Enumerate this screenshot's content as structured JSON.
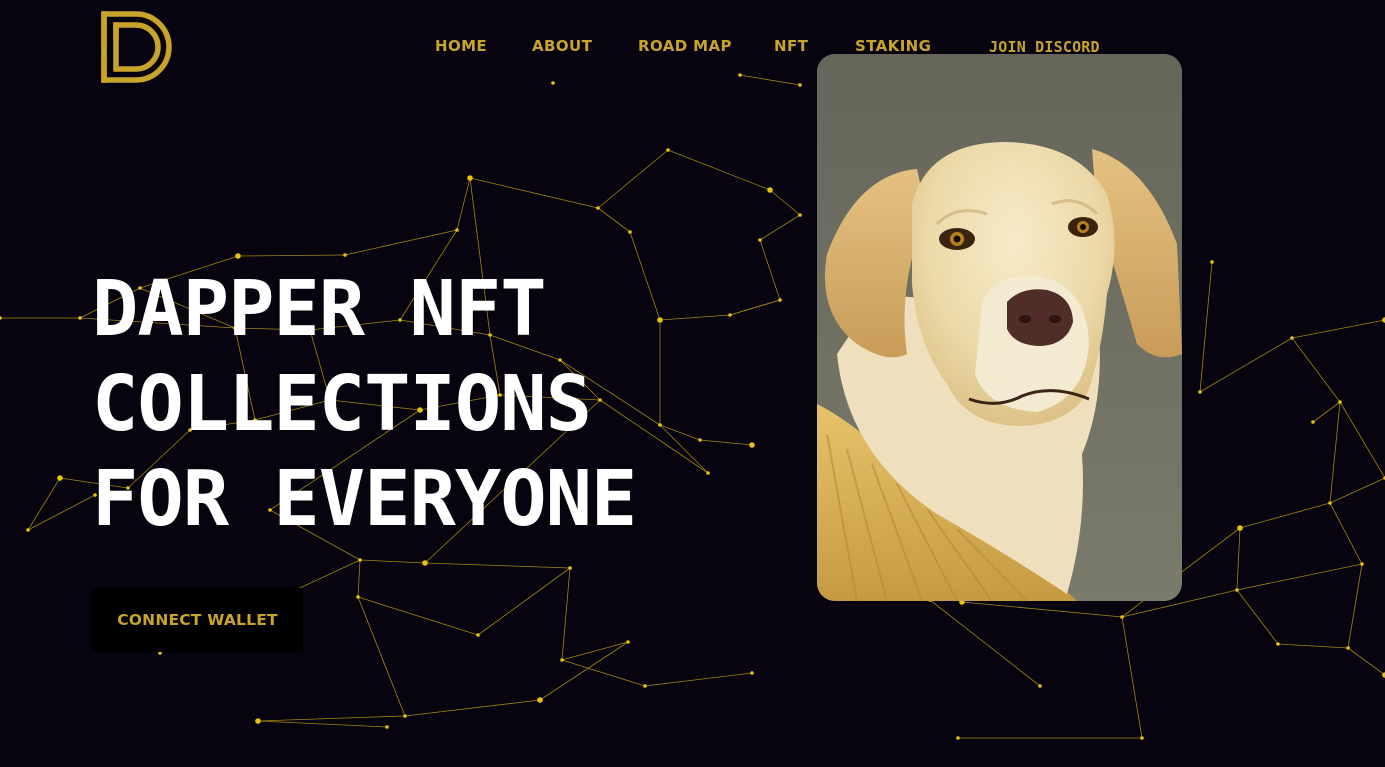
{
  "brand": {
    "logo_icon": "dapper-d-logo-icon",
    "accent": "#c9a42a",
    "background": "#07040f"
  },
  "nav": {
    "items": [
      {
        "label": "HOME"
      },
      {
        "label": "ABOUT"
      },
      {
        "label": "ROAD MAP"
      },
      {
        "label": "NFT"
      },
      {
        "label": "STAKING"
      }
    ],
    "discord_label": "JOIN DISCORD"
  },
  "hero": {
    "title_lines": [
      "DAPPER NFT",
      "COLLECTIONS",
      "FOR EVERYONE"
    ],
    "cta_label": "CONNECT WALLET"
  },
  "nft_card": {
    "image_icon": "labrador-dog-portrait-image"
  }
}
